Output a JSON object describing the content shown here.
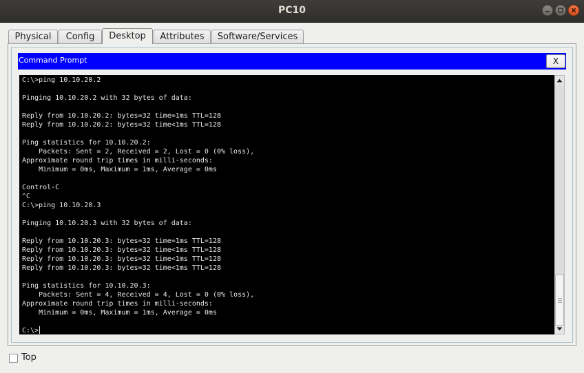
{
  "window": {
    "title": "PC10"
  },
  "tabs": [
    {
      "label": "Physical"
    },
    {
      "label": "Config"
    },
    {
      "label": "Desktop"
    },
    {
      "label": "Attributes"
    },
    {
      "label": "Software/Services"
    }
  ],
  "active_tab": "Desktop",
  "command_prompt": {
    "title": "Command Prompt",
    "close_label": "X",
    "lines": [
      "C:\\>ping 10.10.20.2",
      "",
      "Pinging 10.10.20.2 with 32 bytes of data:",
      "",
      "Reply from 10.10.20.2: bytes=32 time=1ms TTL=128",
      "Reply from 10.10.20.2: bytes=32 time<1ms TTL=128",
      "",
      "Ping statistics for 10.10.20.2:",
      "    Packets: Sent = 2, Received = 2, Lost = 0 (0% loss),",
      "Approximate round trip times in milli-seconds:",
      "    Minimum = 0ms, Maximum = 1ms, Average = 0ms",
      "",
      "Control-C",
      "^C",
      "C:\\>ping 10.10.20.3",
      "",
      "Pinging 10.10.20.3 with 32 bytes of data:",
      "",
      "Reply from 10.10.20.3: bytes=32 time=1ms TTL=128",
      "Reply from 10.10.20.3: bytes=32 time<1ms TTL=128",
      "Reply from 10.10.20.3: bytes=32 time<1ms TTL=128",
      "Reply from 10.10.20.3: bytes=32 time<1ms TTL=128",
      "",
      "Ping statistics for 10.10.20.3:",
      "    Packets: Sent = 4, Received = 4, Lost = 0 (0% loss),",
      "Approximate round trip times in milli-seconds:",
      "    Minimum = 0ms, Maximum = 1ms, Average = 0ms",
      "",
      "C:\\>"
    ]
  },
  "footer": {
    "top_checkbox_label": "Top",
    "top_checked": false
  },
  "colors": {
    "prompt_header": "#0000ff",
    "terminal_bg": "#000000",
    "terminal_fg": "#e9e9e9",
    "close_button": "#e0581f"
  },
  "icons": {
    "minimize": "minimize-icon",
    "maximize": "maximize-icon",
    "close": "close-icon",
    "scroll_up": "arrow-up-icon",
    "scroll_down": "arrow-down-icon"
  }
}
